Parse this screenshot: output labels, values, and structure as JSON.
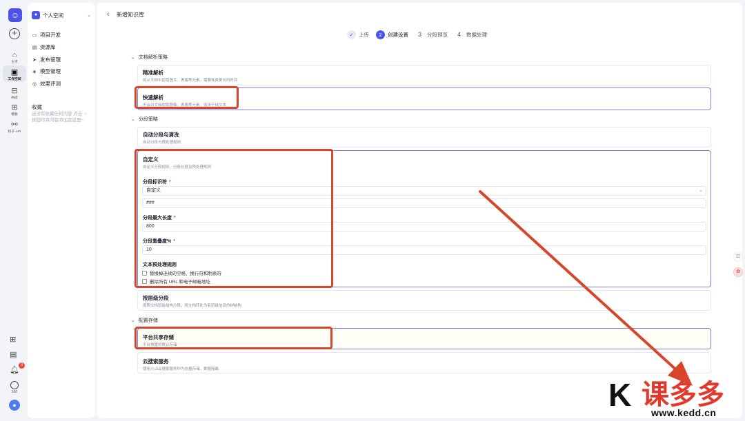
{
  "rail": {
    "items": [
      {
        "icon": "home-icon",
        "label": "主页"
      },
      {
        "icon": "workspace-icon",
        "label": "工作空间"
      },
      {
        "icon": "store-icon",
        "label": "商店"
      },
      {
        "icon": "template-icon",
        "label": "模板"
      },
      {
        "icon": "api-icon",
        "label": "扣子 API"
      }
    ],
    "bottom": {
      "badge_count": "3",
      "coin_label": "500"
    }
  },
  "workspace": {
    "name": "个人空间",
    "menu": [
      {
        "icon": "project-icon",
        "label": "项目开发"
      },
      {
        "icon": "library-icon",
        "label": "资源库"
      },
      {
        "icon": "publish-icon",
        "label": "发布管理"
      },
      {
        "icon": "model-icon",
        "label": "模型管理"
      },
      {
        "icon": "evaluation-icon",
        "label": "效果评测"
      }
    ],
    "favorites_title": "收藏",
    "favorites_empty": "还没有收藏任何内容 点击 ☆ 按钮可将内容添加至这里~"
  },
  "header": {
    "title": "新增知识库"
  },
  "steps": [
    {
      "num": "✓",
      "label": "上传",
      "state": "done"
    },
    {
      "num": "2",
      "label": "创建设置",
      "state": "current"
    },
    {
      "num": "3",
      "label": "分段预览",
      "state": "todo"
    },
    {
      "num": "4",
      "label": "数据处理",
      "state": "todo"
    }
  ],
  "parse": {
    "section": "文档解析策略",
    "precise_title": "精准解析",
    "precise_desc": "将从文档中提取图片、表格等元素，需要耗费更长的时间",
    "fast_title": "快速解析",
    "fast_desc": "不会对文档提取图像、表格等元素，适用于纯文本"
  },
  "segment": {
    "section": "分段策略",
    "auto_title": "自动分段与清洗",
    "auto_desc": "自动分段与预处理规则",
    "custom_title": "自定义",
    "custom_desc": "自定义分段规则、分段长度及预处理规则",
    "identifier_label": "分段标识符",
    "identifier_value": "自定义",
    "identifier_custom": "###",
    "max_len_label": "分段最大长度",
    "max_len_value": "800",
    "overlap_label": "分段重叠度%",
    "overlap_value": "10",
    "rules_label": "文本预处理规则",
    "rule1": "替换掉连续的空格、换行符和制表符",
    "rule2": "删除所有 URL 和电子邮箱地址",
    "hier_title": "按层级分段",
    "hier_desc": "按照文档层级结构分段，将文档转化为有层级信息的树结构"
  },
  "storage": {
    "section": "配置存储",
    "shared_title": "平台共享存储",
    "shared_desc": "平台预置的默认存储",
    "cloud_title": "云搜索服务",
    "cloud_desc": "使用火山云搜索服务作为向量存储，数据隔离"
  },
  "watermark": {
    "brand": "课多多",
    "url": "www.kedd.cn"
  },
  "colors": {
    "accent": "#4d53e8",
    "highlight": "#d8452b"
  }
}
